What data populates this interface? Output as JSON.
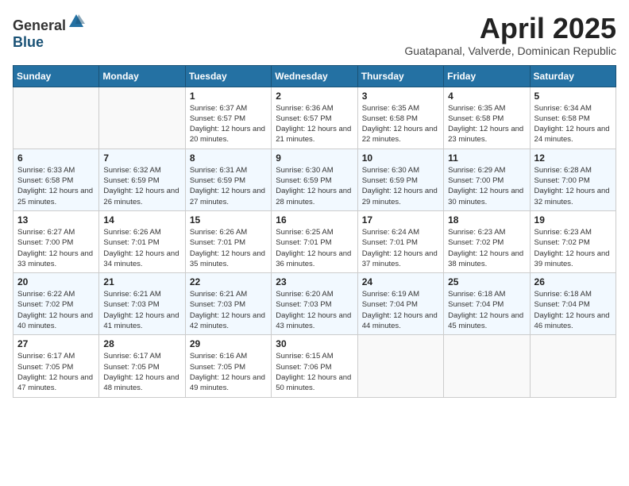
{
  "logo": {
    "general": "General",
    "blue": "Blue"
  },
  "title": "April 2025",
  "location": "Guatapanal, Valverde, Dominican Republic",
  "weekdays": [
    "Sunday",
    "Monday",
    "Tuesday",
    "Wednesday",
    "Thursday",
    "Friday",
    "Saturday"
  ],
  "weeks": [
    [
      {
        "day": null
      },
      {
        "day": null
      },
      {
        "day": "1",
        "sunrise": "Sunrise: 6:37 AM",
        "sunset": "Sunset: 6:57 PM",
        "daylight": "Daylight: 12 hours and 20 minutes."
      },
      {
        "day": "2",
        "sunrise": "Sunrise: 6:36 AM",
        "sunset": "Sunset: 6:57 PM",
        "daylight": "Daylight: 12 hours and 21 minutes."
      },
      {
        "day": "3",
        "sunrise": "Sunrise: 6:35 AM",
        "sunset": "Sunset: 6:58 PM",
        "daylight": "Daylight: 12 hours and 22 minutes."
      },
      {
        "day": "4",
        "sunrise": "Sunrise: 6:35 AM",
        "sunset": "Sunset: 6:58 PM",
        "daylight": "Daylight: 12 hours and 23 minutes."
      },
      {
        "day": "5",
        "sunrise": "Sunrise: 6:34 AM",
        "sunset": "Sunset: 6:58 PM",
        "daylight": "Daylight: 12 hours and 24 minutes."
      }
    ],
    [
      {
        "day": "6",
        "sunrise": "Sunrise: 6:33 AM",
        "sunset": "Sunset: 6:58 PM",
        "daylight": "Daylight: 12 hours and 25 minutes."
      },
      {
        "day": "7",
        "sunrise": "Sunrise: 6:32 AM",
        "sunset": "Sunset: 6:59 PM",
        "daylight": "Daylight: 12 hours and 26 minutes."
      },
      {
        "day": "8",
        "sunrise": "Sunrise: 6:31 AM",
        "sunset": "Sunset: 6:59 PM",
        "daylight": "Daylight: 12 hours and 27 minutes."
      },
      {
        "day": "9",
        "sunrise": "Sunrise: 6:30 AM",
        "sunset": "Sunset: 6:59 PM",
        "daylight": "Daylight: 12 hours and 28 minutes."
      },
      {
        "day": "10",
        "sunrise": "Sunrise: 6:30 AM",
        "sunset": "Sunset: 6:59 PM",
        "daylight": "Daylight: 12 hours and 29 minutes."
      },
      {
        "day": "11",
        "sunrise": "Sunrise: 6:29 AM",
        "sunset": "Sunset: 7:00 PM",
        "daylight": "Daylight: 12 hours and 30 minutes."
      },
      {
        "day": "12",
        "sunrise": "Sunrise: 6:28 AM",
        "sunset": "Sunset: 7:00 PM",
        "daylight": "Daylight: 12 hours and 32 minutes."
      }
    ],
    [
      {
        "day": "13",
        "sunrise": "Sunrise: 6:27 AM",
        "sunset": "Sunset: 7:00 PM",
        "daylight": "Daylight: 12 hours and 33 minutes."
      },
      {
        "day": "14",
        "sunrise": "Sunrise: 6:26 AM",
        "sunset": "Sunset: 7:01 PM",
        "daylight": "Daylight: 12 hours and 34 minutes."
      },
      {
        "day": "15",
        "sunrise": "Sunrise: 6:26 AM",
        "sunset": "Sunset: 7:01 PM",
        "daylight": "Daylight: 12 hours and 35 minutes."
      },
      {
        "day": "16",
        "sunrise": "Sunrise: 6:25 AM",
        "sunset": "Sunset: 7:01 PM",
        "daylight": "Daylight: 12 hours and 36 minutes."
      },
      {
        "day": "17",
        "sunrise": "Sunrise: 6:24 AM",
        "sunset": "Sunset: 7:01 PM",
        "daylight": "Daylight: 12 hours and 37 minutes."
      },
      {
        "day": "18",
        "sunrise": "Sunrise: 6:23 AM",
        "sunset": "Sunset: 7:02 PM",
        "daylight": "Daylight: 12 hours and 38 minutes."
      },
      {
        "day": "19",
        "sunrise": "Sunrise: 6:23 AM",
        "sunset": "Sunset: 7:02 PM",
        "daylight": "Daylight: 12 hours and 39 minutes."
      }
    ],
    [
      {
        "day": "20",
        "sunrise": "Sunrise: 6:22 AM",
        "sunset": "Sunset: 7:02 PM",
        "daylight": "Daylight: 12 hours and 40 minutes."
      },
      {
        "day": "21",
        "sunrise": "Sunrise: 6:21 AM",
        "sunset": "Sunset: 7:03 PM",
        "daylight": "Daylight: 12 hours and 41 minutes."
      },
      {
        "day": "22",
        "sunrise": "Sunrise: 6:21 AM",
        "sunset": "Sunset: 7:03 PM",
        "daylight": "Daylight: 12 hours and 42 minutes."
      },
      {
        "day": "23",
        "sunrise": "Sunrise: 6:20 AM",
        "sunset": "Sunset: 7:03 PM",
        "daylight": "Daylight: 12 hours and 43 minutes."
      },
      {
        "day": "24",
        "sunrise": "Sunrise: 6:19 AM",
        "sunset": "Sunset: 7:04 PM",
        "daylight": "Daylight: 12 hours and 44 minutes."
      },
      {
        "day": "25",
        "sunrise": "Sunrise: 6:18 AM",
        "sunset": "Sunset: 7:04 PM",
        "daylight": "Daylight: 12 hours and 45 minutes."
      },
      {
        "day": "26",
        "sunrise": "Sunrise: 6:18 AM",
        "sunset": "Sunset: 7:04 PM",
        "daylight": "Daylight: 12 hours and 46 minutes."
      }
    ],
    [
      {
        "day": "27",
        "sunrise": "Sunrise: 6:17 AM",
        "sunset": "Sunset: 7:05 PM",
        "daylight": "Daylight: 12 hours and 47 minutes."
      },
      {
        "day": "28",
        "sunrise": "Sunrise: 6:17 AM",
        "sunset": "Sunset: 7:05 PM",
        "daylight": "Daylight: 12 hours and 48 minutes."
      },
      {
        "day": "29",
        "sunrise": "Sunrise: 6:16 AM",
        "sunset": "Sunset: 7:05 PM",
        "daylight": "Daylight: 12 hours and 49 minutes."
      },
      {
        "day": "30",
        "sunrise": "Sunrise: 6:15 AM",
        "sunset": "Sunset: 7:06 PM",
        "daylight": "Daylight: 12 hours and 50 minutes."
      },
      {
        "day": null
      },
      {
        "day": null
      },
      {
        "day": null
      }
    ]
  ]
}
